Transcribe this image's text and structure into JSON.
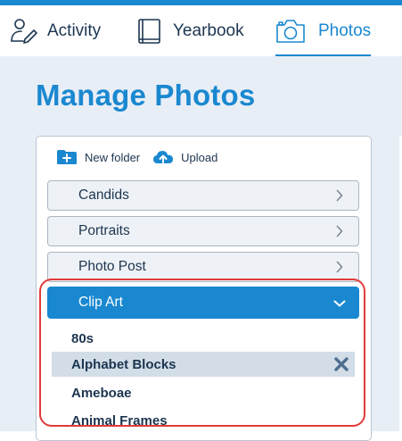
{
  "tabs": [
    {
      "label": "Activity",
      "icon": "person-pencil-icon"
    },
    {
      "label": "Yearbook",
      "icon": "book-icon"
    },
    {
      "label": "Photos",
      "icon": "camera-icon",
      "active": true
    }
  ],
  "page": {
    "title": "Manage Photos"
  },
  "toolbar": {
    "new_folder": {
      "label": "New folder",
      "icon": "folder-plus-icon"
    },
    "upload": {
      "label": "Upload",
      "icon": "cloud-upload-icon"
    }
  },
  "folders": [
    {
      "label": "Candids",
      "expanded": false
    },
    {
      "label": "Portraits",
      "expanded": false
    },
    {
      "label": "Photo Post",
      "expanded": false
    },
    {
      "label": "Clip Art",
      "expanded": true
    }
  ],
  "clip_art_items": [
    {
      "label": "80s"
    },
    {
      "label": "Alphabet Blocks",
      "selected": true
    },
    {
      "label": "Ameboae"
    },
    {
      "label": "Animal Frames"
    }
  ],
  "colors": {
    "accent": "#1a88d0",
    "text": "#1c3550",
    "highlight": "#e23b3b",
    "background": "#e8eef6"
  }
}
